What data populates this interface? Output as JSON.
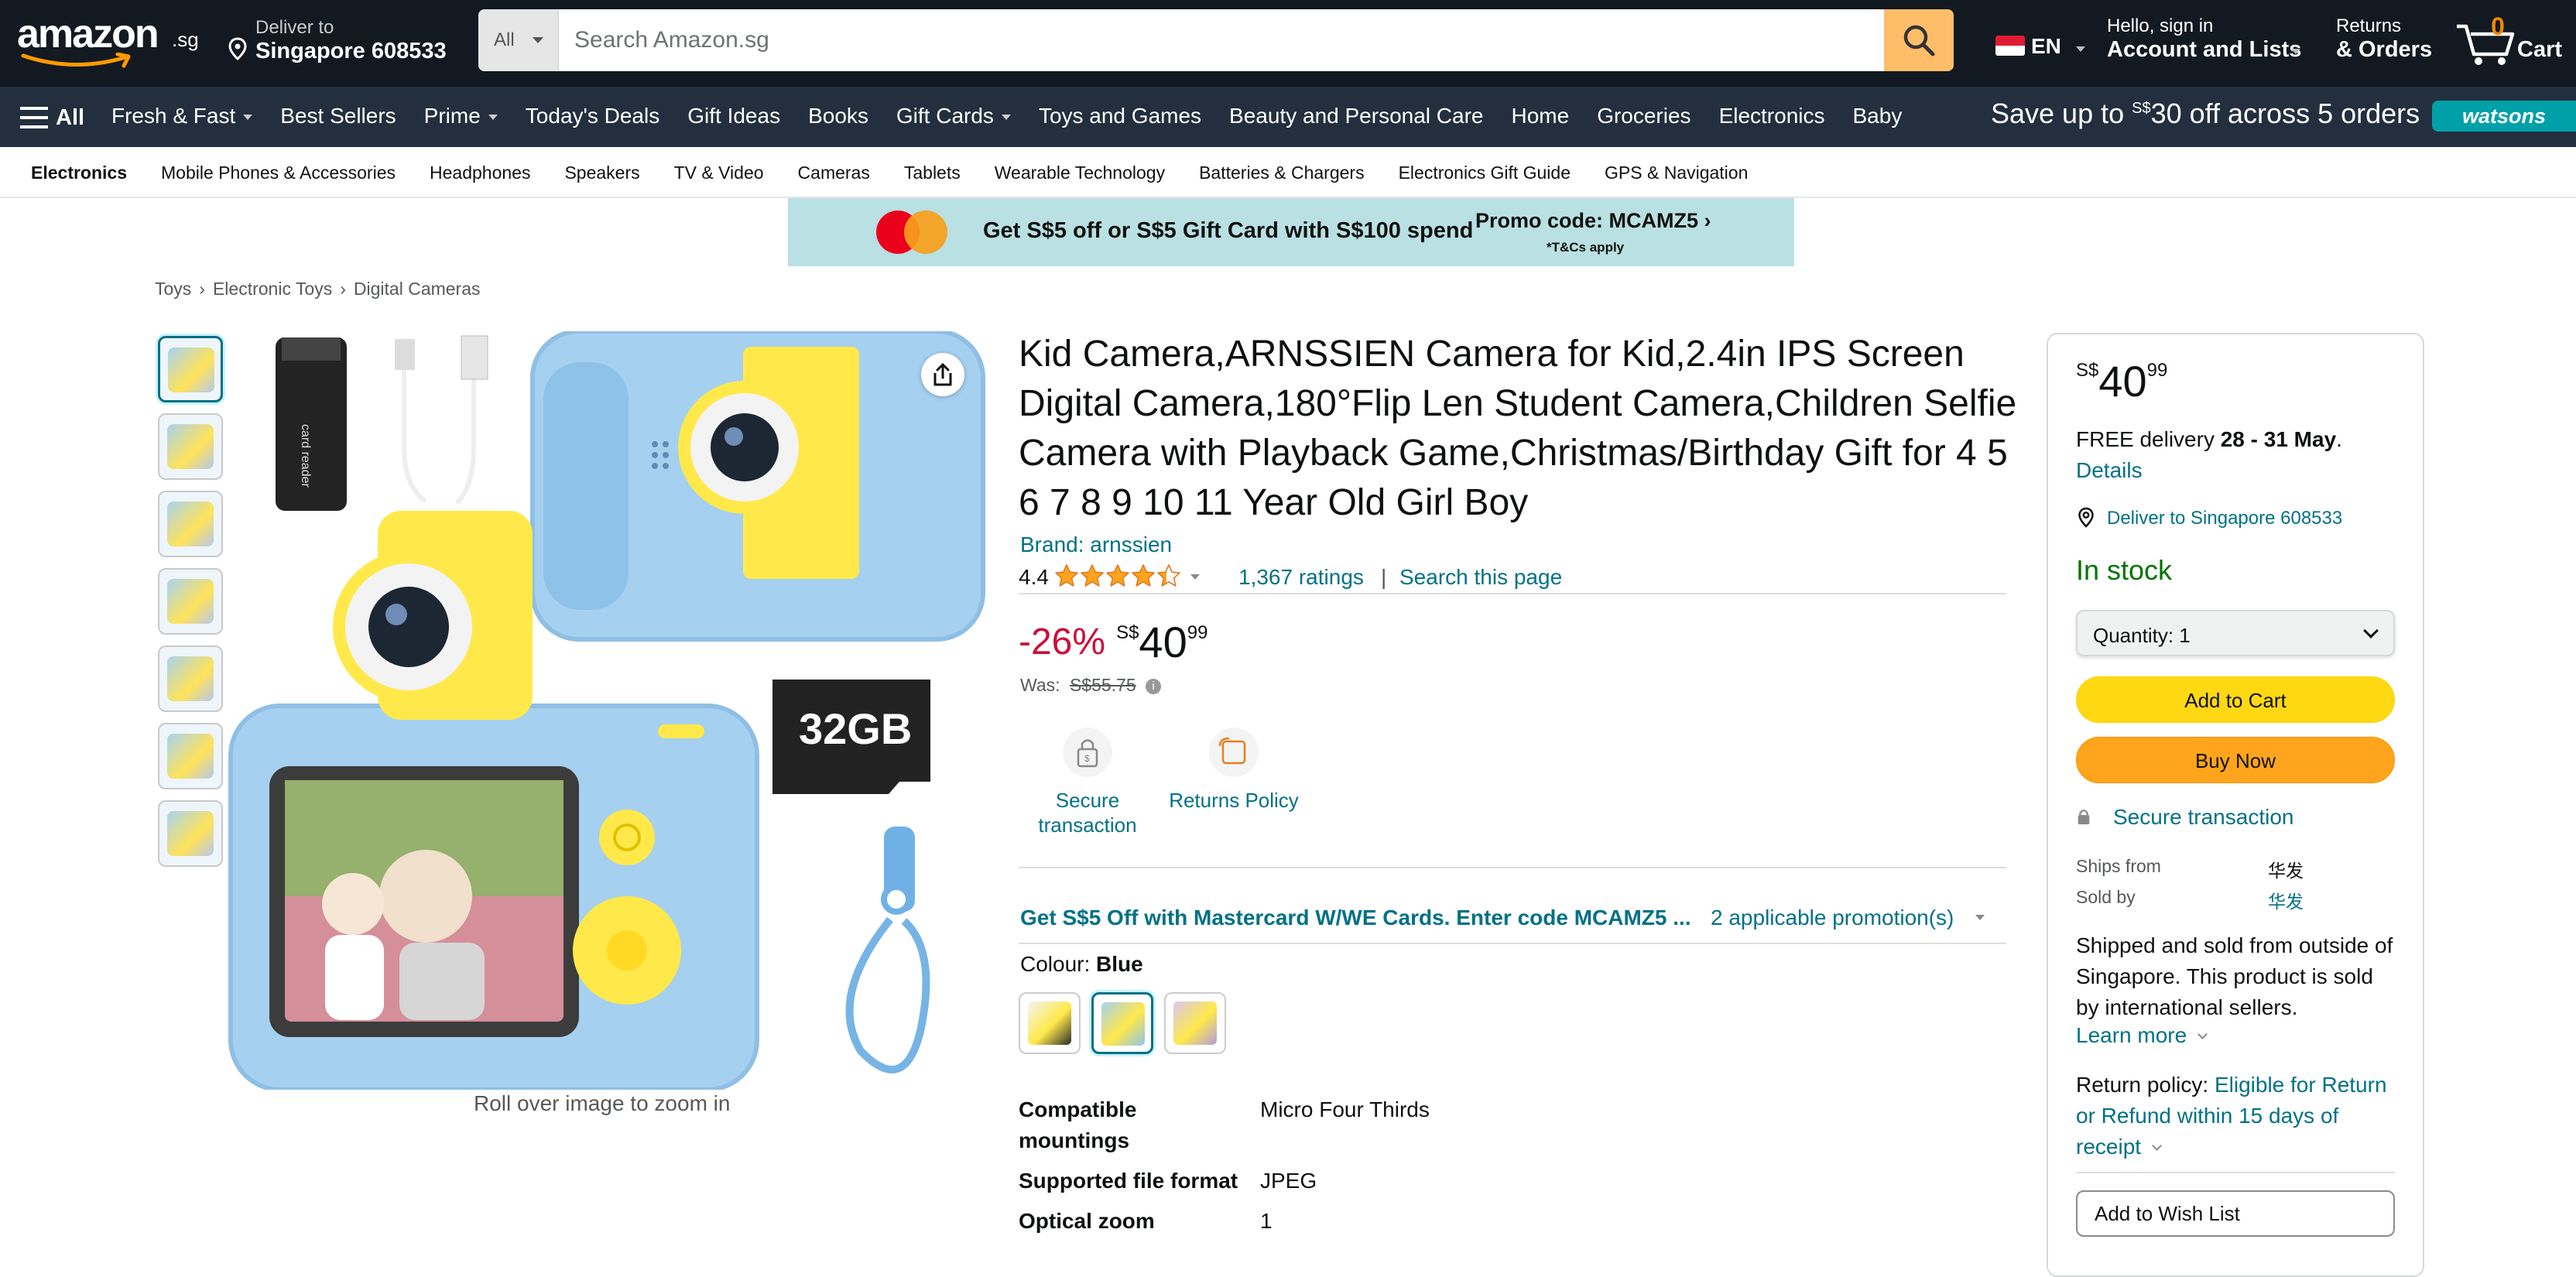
{
  "header": {
    "logo_text": "amazon",
    "logo_suffix": ".sg",
    "deliver_line1": "Deliver to",
    "deliver_line2": "Singapore 608533",
    "search_category": "All",
    "search_placeholder": "Search Amazon.sg",
    "language": "EN",
    "account_line1": "Hello, sign in",
    "account_line2": "Account and Lists",
    "returns_line1": "Returns",
    "returns_line2": "& Orders",
    "cart_count": "0",
    "cart_label": "Cart"
  },
  "navbar": {
    "all_label": "All",
    "links": [
      {
        "label": "Fresh & Fast",
        "dropdown": true
      },
      {
        "label": "Best Sellers",
        "dropdown": false
      },
      {
        "label": "Prime",
        "dropdown": true
      },
      {
        "label": "Today's Deals",
        "dropdown": false
      },
      {
        "label": "Gift Ideas",
        "dropdown": false
      },
      {
        "label": "Books",
        "dropdown": false
      },
      {
        "label": "Gift Cards",
        "dropdown": true
      },
      {
        "label": "Toys and Games",
        "dropdown": false
      },
      {
        "label": "Beauty and Personal Care",
        "dropdown": false
      },
      {
        "label": "Home",
        "dropdown": false
      },
      {
        "label": "Groceries",
        "dropdown": false
      },
      {
        "label": "Electronics",
        "dropdown": false
      },
      {
        "label": "Baby",
        "dropdown": false
      }
    ],
    "promo_prefix": "Save up to ",
    "promo_currency": "S$",
    "promo_suffix": "30 off across 5 orders",
    "watsons": "watsons"
  },
  "subnav": [
    "Electronics",
    "Mobile Phones & Accessories",
    "Headphones",
    "Speakers",
    "TV & Video",
    "Cameras",
    "Tablets",
    "Wearable Technology",
    "Batteries & Chargers",
    "Electronics Gift Guide",
    "GPS & Navigation"
  ],
  "banner": {
    "offer": "Get S$5 off or S$5 Gift Card with S$100 spend",
    "code": "Promo code: MCAMZ5 ›",
    "tc": "*T&Cs apply"
  },
  "breadcrumb": [
    "Toys",
    "Electronic Toys",
    "Digital Cameras"
  ],
  "gallery": {
    "zoom_hint": "Roll over image to zoom in",
    "thumbnail_count": 7,
    "selected_thumbnail": 1,
    "image_text": "32GB"
  },
  "product": {
    "title": "Kid Camera,ARNSSIEN Camera for Kid,2.4in IPS Screen Digital Camera,180°Flip Len Student Camera,Children Selfie Camera with Playback Game,Christmas/Birthday Gift for 4 5 6 7 8 9 10 11 Year Old Girl Boy",
    "brand": "Brand: arnssien",
    "rating": "4.4",
    "rating_value": 4.4,
    "ratings_count": "1,367 ratings",
    "separator": "|",
    "search_page": "Search this page",
    "discount": "-26%",
    "currency": "S$",
    "price_whole": "40",
    "price_fraction": "99",
    "was_label": "Was:",
    "was_price": "S$55.75",
    "features": [
      {
        "icon": "lock-icon",
        "label": "Secure transaction"
      },
      {
        "icon": "returns-icon",
        "label": "Returns Policy"
      }
    ],
    "promo_text": "Get S$5 Off with Mastercard W/WE Cards. Enter code MCAMZ5 ...",
    "promo_count": "2 applicable promotion(s)",
    "colour_label": "Colour:",
    "colour_value": "Blue",
    "swatches": [
      "Yellow",
      "Blue",
      "Purple"
    ],
    "specs": [
      {
        "key": "Compatible mountings",
        "value": "Micro Four Thirds"
      },
      {
        "key": "Supported file format",
        "value": "JPEG"
      },
      {
        "key": "Optical zoom",
        "value": "1"
      }
    ]
  },
  "buybox": {
    "currency": "S$",
    "price_whole": "40",
    "price_fraction": "99",
    "free_delivery": "FREE delivery",
    "delivery_dates": "28 - 31 May",
    "delivery_period": ".",
    "details": "Details",
    "deliver_to": "Deliver to Singapore 608533",
    "stock": "In stock",
    "quantity": "Quantity:  1",
    "add_to_cart": "Add to Cart",
    "buy_now": "Buy Now",
    "secure": "Secure transaction",
    "ships_from_label": "Ships from",
    "ships_from_value": "华发",
    "sold_by_label": "Sold by",
    "sold_by_value": "华发",
    "shipped_note": "Shipped and sold from outside of Singapore. This product is sold by international sellers.",
    "learn_more": "Learn more",
    "return_label": "Return policy: ",
    "return_link": "Eligible for Return or Refund within 15 days of receipt",
    "wish_list": "Add to Wish List"
  },
  "colors": {
    "nav_dark": "#131921",
    "nav_secondary": "#232f3e",
    "link": "#007185",
    "deal_red": "#cc0c39",
    "in_stock": "#007600",
    "cart_button": "#ffd814",
    "buy_button": "#ffa41c",
    "search_button": "#febd69",
    "star": "#ffa41c"
  }
}
